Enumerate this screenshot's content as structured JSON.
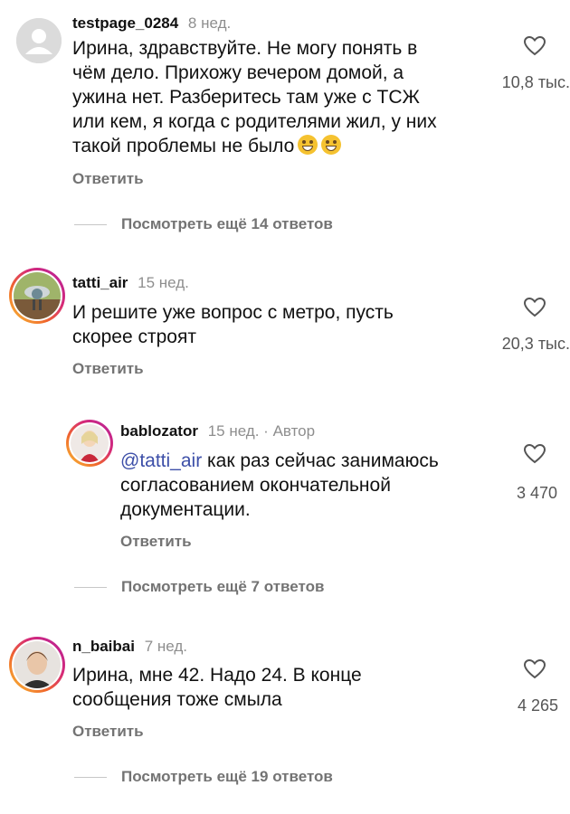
{
  "comments": [
    {
      "username": "testpage_0284",
      "time": "8 нед.",
      "text_lines": [
        "Ирина, здравствуйте. Не могу понять в",
        "чём дело. Прихожу вечером домой, а",
        "ужина нет. Разберитесь там уже с ТСЖ",
        "или кем, я когда с родителями жил, у них",
        "такой проблемы не было"
      ],
      "likes": "10,8 тыс.",
      "reply_label": "Ответить",
      "view_more": "Посмотреть ещё 14 ответов",
      "icon": "heart-outline-icon"
    },
    {
      "username": "tatti_air",
      "time": "15 нед.",
      "text_lines": [
        "И решите уже вопрос с метро, пусть",
        "скорее строят"
      ],
      "likes": "20,3 тыс.",
      "reply_label": "Ответить",
      "icon": "heart-outline-icon"
    },
    {
      "username": "bablozator",
      "time": "15 нед.",
      "separator": "·",
      "author_label": "Автор",
      "mention": "@tatti_air",
      "text_lines": [
        " как раз сейчас занимаюсь",
        "согласованием окончательной",
        "документации."
      ],
      "likes": "3 470",
      "reply_label": "Ответить",
      "view_more": "Посмотреть ещё 7 ответов",
      "icon": "heart-outline-icon"
    },
    {
      "username": "n_baibai",
      "time": "7 нед.",
      "text_lines": [
        "Ирина, мне 42. Надо 24. В конце",
        "сообщения тоже смыла"
      ],
      "likes": "4 265",
      "reply_label": "Ответить",
      "view_more": "Посмотреть ещё 19 ответов",
      "icon": "heart-outline-icon"
    }
  ],
  "colors": {
    "mention": "#3d4fa8",
    "muted": "#737373",
    "story_ring": "#d62a78"
  }
}
